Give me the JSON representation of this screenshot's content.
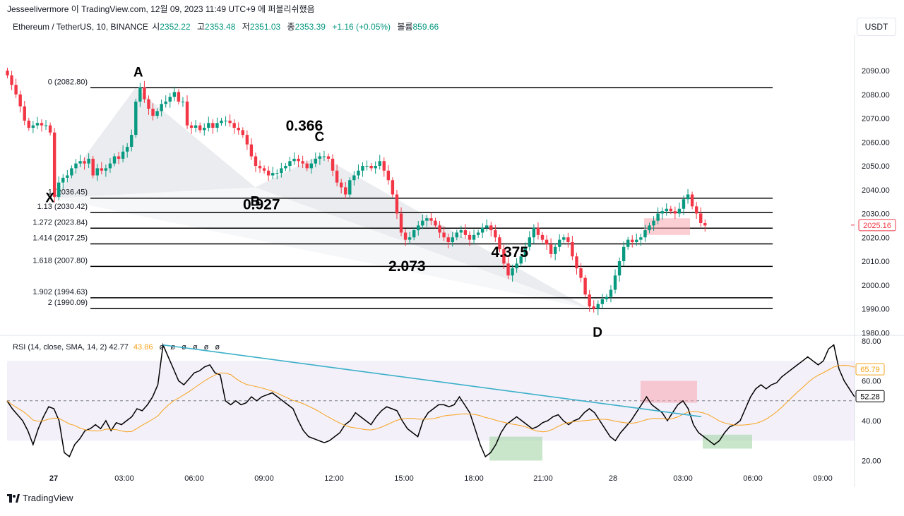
{
  "header": {
    "attribution": "Jesseelivermore 이 TradingView.com, 12월 09, 2023 11:49 UTC+9 에 퍼블리쉬했음"
  },
  "legend": {
    "symbol": "Ethereum / TetherUS, 10, BINANCE",
    "open_label": "시",
    "open": "2352.22",
    "high_label": "고",
    "high": "2353.48",
    "low_label": "저",
    "low": "2351.03",
    "close_label": "종",
    "close": "2353.39",
    "change": "+1.16 (+0.05%)",
    "volume_label": "볼륨",
    "volume": "859.66"
  },
  "unit_button": "USDT",
  "rsi_legend": {
    "title": "RSI (14, close, SMA, 14, 2)",
    "rsi": "42.77",
    "ma": "43.86",
    "dots": "ø ø ø ø ø ø"
  },
  "brand": "TradingView",
  "colors": {
    "up": "#089981",
    "down": "#f23645",
    "rsi": "#000000",
    "rsi_ma": "#f7a21b",
    "trend": "#3bb0c9"
  },
  "chart_data": [
    {
      "type": "candlestick",
      "y_axis": {
        "min": 1975,
        "max": 2095,
        "ticks": [
          "2090.00",
          "2080.00",
          "2070.00",
          "2060.00",
          "2050.00",
          "2040.00",
          "2030.00",
          "2020.00",
          "2010.00",
          "2000.00",
          "1990.00",
          "1980.00"
        ]
      },
      "x_ticks": [
        "27",
        "03:00",
        "06:00",
        "09:00",
        "12:00",
        "15:00",
        "18:00",
        "21:00",
        "28",
        "03:00",
        "06:00",
        "09:00"
      ],
      "last_price": "2025.16",
      "closes": [
        2088,
        2084,
        2080,
        2075,
        2069,
        2066,
        2067,
        2068,
        2067,
        2067,
        2064,
        2037,
        2043,
        2045,
        2046,
        2049,
        2051,
        2052,
        2051,
        2053,
        2046,
        2049,
        2048,
        2049,
        2051,
        2054,
        2053,
        2056,
        2058,
        2063,
        2077,
        2083,
        2078,
        2074,
        2071,
        2073,
        2076,
        2077,
        2079,
        2081,
        2077,
        2077,
        2067,
        2066,
        2067,
        2065,
        2066,
        2068,
        2066,
        2068,
        2069,
        2069,
        2068,
        2066,
        2065,
        2063,
        2059,
        2054,
        2050,
        2049,
        2048,
        2046,
        2047,
        2047,
        2049,
        2050,
        2052,
        2053,
        2052,
        2051,
        2049,
        2051,
        2053,
        2054,
        2054,
        2053,
        2048,
        2043,
        2041,
        2038,
        2044,
        2046,
        2048,
        2050,
        2050,
        2049,
        2050,
        2052,
        2048,
        2044,
        2038,
        2030,
        2022,
        2019,
        2020,
        2023,
        2025,
        2027,
        2028,
        2027,
        2025,
        2022,
        2020,
        2018,
        2020,
        2022,
        2023,
        2021,
        2019,
        2021,
        2022,
        2024,
        2025,
        2023,
        2020,
        2015,
        2009,
        2004,
        2007,
        2009,
        2012,
        2016,
        2020,
        2024,
        2021,
        2019,
        2017,
        2013,
        2016,
        2019,
        2020,
        2018,
        2012,
        2007,
        2003,
        1996,
        1991,
        1990,
        1992,
        1994,
        1995,
        1998,
        2004,
        2010,
        2016,
        2019,
        2018,
        2019,
        2020,
        2023,
        2025,
        2027,
        2030,
        2031,
        2032,
        2031,
        2030,
        2032,
        2036,
        2038,
        2033,
        2030,
        2026,
        2025
      ],
      "fib_levels": [
        {
          "label": "0 (2082.80)",
          "value": 2082.8
        },
        {
          "label": "1 (2036.45)",
          "value": 2036.45
        },
        {
          "label": "1.13 (2030.42)",
          "value": 2030.42
        },
        {
          "label": "1.272 (2023.84)",
          "value": 2023.84
        },
        {
          "label": "1.414 (2017.25)",
          "value": 2017.25
        },
        {
          "label": "1.618 (2007.80)",
          "value": 2007.8
        },
        {
          "label": "1.902 (1994.63)",
          "value": 1994.63
        },
        {
          "label": "2 (1990.09)",
          "value": 1990.09
        }
      ],
      "pattern_points": [
        {
          "label": "X",
          "index": 11,
          "value": 2036.45
        },
        {
          "label": "A",
          "index": 30,
          "value": 2082.8
        },
        {
          "label": "B",
          "index": 58,
          "value": 2041
        },
        {
          "label": "C",
          "index": 73,
          "value": 2054.5
        },
        {
          "label": "D",
          "index": 136,
          "value": 1990.09
        }
      ],
      "ratio_labels": [
        {
          "text": "0.366",
          "index": 48,
          "value": 2069
        },
        {
          "text": "0.927",
          "index": 38,
          "value": 2036
        },
        {
          "text": "2.073",
          "index": 72,
          "value": 2010
        },
        {
          "text": "4.375",
          "index": 96,
          "value": 2016
        }
      ]
    },
    {
      "type": "line",
      "name": "RSI",
      "y_axis": {
        "min": 15,
        "max": 80,
        "ticks": [
          "80.00",
          "60.00",
          "40.00",
          "20.00"
        ],
        "band": [
          30,
          70
        ],
        "mid": 50
      },
      "last_rsi": "52.28",
      "last_ma": "65.79",
      "rsi": [
        50,
        46,
        43,
        40,
        35,
        28,
        36,
        42,
        47,
        46,
        40,
        24,
        22,
        28,
        31,
        35,
        36,
        38,
        36,
        40,
        35,
        39,
        38,
        40,
        42,
        46,
        45,
        48,
        52,
        58,
        78,
        72,
        66,
        60,
        58,
        61,
        64,
        65,
        67,
        68,
        64,
        63,
        50,
        48,
        50,
        48,
        49,
        52,
        50,
        52,
        53,
        54,
        52,
        50,
        48,
        46,
        40,
        35,
        32,
        31,
        30,
        29,
        30,
        32,
        34,
        38,
        40,
        44,
        42,
        40,
        38,
        42,
        45,
        47,
        46,
        45,
        40,
        36,
        34,
        32,
        40,
        44,
        46,
        48,
        48,
        47,
        48,
        52,
        48,
        44,
        36,
        28,
        22,
        24,
        28,
        34,
        38,
        40,
        42,
        40,
        38,
        36,
        37,
        39,
        40,
        42,
        43,
        40,
        38,
        40,
        41,
        44,
        46,
        44,
        40,
        36,
        32,
        30,
        34,
        37,
        40,
        44,
        48,
        52,
        48,
        46,
        44,
        40,
        44,
        48,
        50,
        46,
        38,
        34,
        32,
        30,
        28,
        30,
        34,
        37,
        38,
        40,
        46,
        52,
        56,
        58,
        56,
        58,
        59,
        62,
        64,
        66,
        68,
        70,
        72,
        70,
        68,
        70,
        76,
        78,
        66,
        60,
        56,
        52
      ]
    }
  ]
}
